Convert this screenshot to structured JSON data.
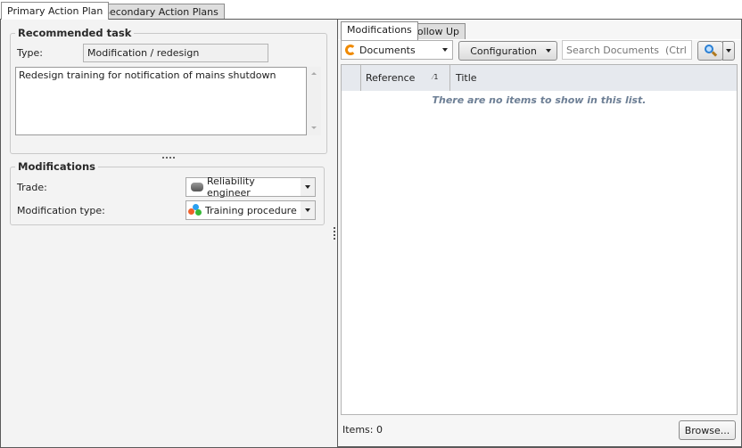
{
  "tabs": [
    {
      "label": "Primary Action Plan",
      "active": true
    },
    {
      "label": "Secondary Action Plans",
      "active": false
    }
  ],
  "recommended_task": {
    "legend": "Recommended task",
    "type_label": "Type:",
    "type_value": "Modification / redesign",
    "description": "Redesign training for notification of mains shutdown"
  },
  "modifications": {
    "legend": "Modifications",
    "trade_label": "Trade:",
    "trade_value": "Reliability engineer",
    "trade_icon": "engineer-icon",
    "modtype_label": "Modification type:",
    "modtype_value": "Training procedure",
    "modtype_icon": "training-icon"
  },
  "right_panel": {
    "tabs": [
      {
        "label": "Modifications",
        "active": true
      },
      {
        "label": "Follow Up",
        "active": false
      }
    ],
    "documents_label": "Documents",
    "configuration_label": "Configuration",
    "search_placeholder": "Search Documents  (Ctrl+F)",
    "grid": {
      "columns": [
        "Reference",
        "Title"
      ],
      "sort_indicator": "1",
      "empty_message": "There are no items to show in this list."
    },
    "items_label": "Items: 0",
    "browse_label": "Browse..."
  }
}
